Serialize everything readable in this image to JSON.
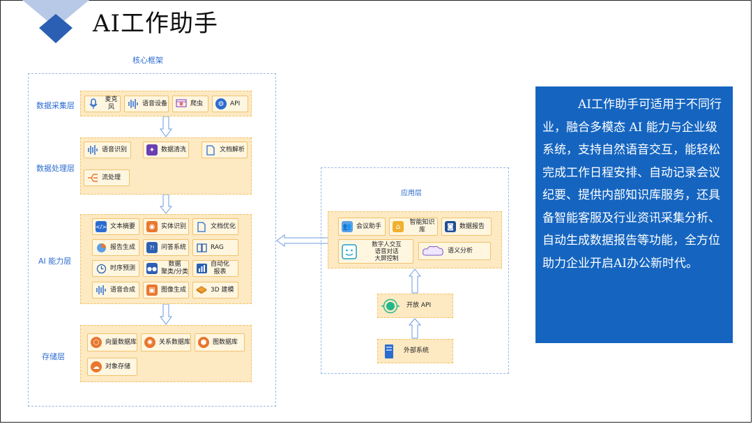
{
  "page": {
    "title": "AI工作助手"
  },
  "colors": {
    "accent": "#2b6cd1",
    "panel": "#1565c0",
    "layer_bg": "#fde9c2",
    "item_border": "#efc36f"
  },
  "core": {
    "title": "核心框架",
    "layers": {
      "collect": {
        "label": "数据采集层",
        "items": [
          {
            "label": "麦克风",
            "icon": "microphone-icon"
          },
          {
            "label": "语音设备",
            "icon": "audio-wave-icon"
          },
          {
            "label": "爬虫",
            "icon": "crawler-icon"
          },
          {
            "label": "API",
            "icon": "api-icon"
          }
        ]
      },
      "process": {
        "label": "数据处理层",
        "items": [
          {
            "label": "语音识别",
            "icon": "audio-wave-icon"
          },
          {
            "label": "数据清洗",
            "icon": "data-clean-icon"
          },
          {
            "label": "文档解析",
            "icon": "document-icon"
          },
          {
            "label": "流处理",
            "icon": "stream-icon"
          }
        ]
      },
      "ai": {
        "label": "AI 能力层",
        "items": [
          {
            "label": "文本摘要",
            "icon": "code-icon"
          },
          {
            "label": "实体识别",
            "icon": "entity-icon"
          },
          {
            "label": "文档优化",
            "icon": "document-icon"
          },
          {
            "label": "报告生成",
            "icon": "pie-chart-icon"
          },
          {
            "label": "问答系统",
            "icon": "qa-icon"
          },
          {
            "label": "RAG",
            "icon": "book-icon"
          },
          {
            "label": "时序预测",
            "icon": "clock-icon"
          },
          {
            "label": "数据\n聚类/分类",
            "icon": "cluster-icon"
          },
          {
            "label": "自动化\n报表",
            "icon": "bar-chart-icon"
          },
          {
            "label": "语音合成",
            "icon": "audio-wave-icon"
          },
          {
            "label": "图像生成",
            "icon": "image-icon"
          },
          {
            "label": "3D 建模",
            "icon": "cube-icon"
          }
        ]
      },
      "storage": {
        "label": "存储层",
        "items": [
          {
            "label": "向量数据库",
            "icon": "vector-db-icon"
          },
          {
            "label": "关系数据库",
            "icon": "relation-db-icon"
          },
          {
            "label": "图数据库",
            "icon": "graph-db-icon"
          },
          {
            "label": "对象存储",
            "icon": "cloud-storage-icon"
          }
        ]
      }
    }
  },
  "app": {
    "title": "应用层",
    "items": [
      {
        "label": "会议助手",
        "icon": "meeting-icon"
      },
      {
        "label": "智能知识库",
        "icon": "knowledge-icon"
      },
      {
        "label": "数据报告",
        "icon": "robot-icon"
      },
      {
        "label": "数字人交互\n语音对话\n大屏控制",
        "icon": "digital-human-icon"
      },
      {
        "label": "语义分析",
        "icon": "cloud-icon"
      }
    ],
    "open_api": "开放 API",
    "external": "外部系统"
  },
  "description": "　　　AI工作助手可适用于不同行业，融合多模态 AI 能力与企业级系统，支持自然语音交互，能轻松完成工作日程安排、自动记录会议纪要、提供内部知识库服务，还具备智能客服及行业资讯采集分析、自动生成数据报告等功能，全方位助力企业开启AI办公新时代。"
}
